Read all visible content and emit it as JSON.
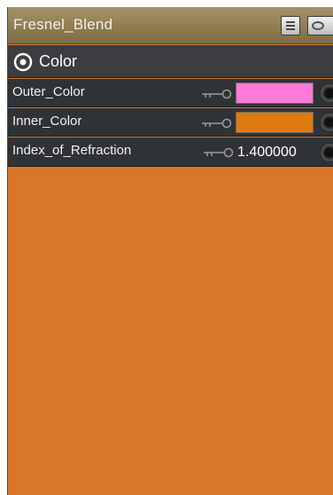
{
  "node": {
    "title": "Fresnel_Blend",
    "buttons": [
      {
        "name": "menu",
        "icon": "menu-icon"
      },
      {
        "name": "preview-toggle",
        "icon": "eye-icon"
      }
    ]
  },
  "section": {
    "label": "Color",
    "icon": "collapse-icon"
  },
  "params": [
    {
      "label": "Outer_Color",
      "type": "color",
      "color": "#ff7ad8"
    },
    {
      "label": "Inner_Color",
      "type": "color",
      "color": "#e07a0e"
    },
    {
      "label": "Index_of_Refraction",
      "type": "value",
      "value": "1.400000"
    }
  ],
  "preview": {
    "color": "#d97628"
  }
}
